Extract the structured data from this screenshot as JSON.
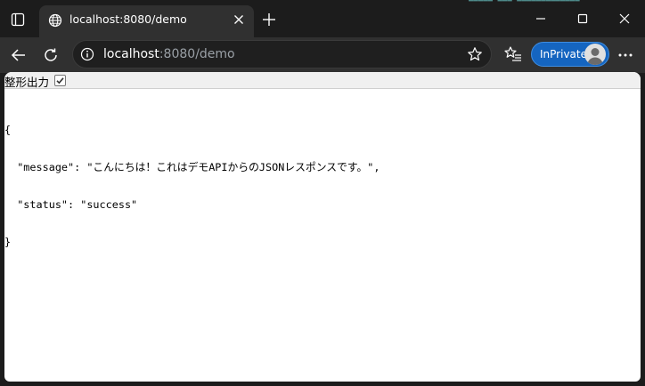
{
  "browser": {
    "tab": {
      "title": "localhost:8080/demo"
    },
    "address": {
      "host": "localhost",
      "rest": ":8080/demo"
    },
    "inprivate_label": "InPrivate",
    "accent": "#1565c0",
    "icons": [
      "tab-actions-icon",
      "globe-icon",
      "close-tab-icon",
      "new-tab-icon",
      "minimize-icon",
      "maximize-icon",
      "close-window-icon",
      "back-icon",
      "refresh-icon",
      "info-icon",
      "star-icon",
      "favorites-icon",
      "avatar",
      "more-icon"
    ]
  },
  "page": {
    "pretty_print_label": "整形出力",
    "pretty_print_checked": true,
    "json_lines": [
      "{",
      "  \"message\": \"こんにちは！これはデモAPIからのJSONレスポンスです。\",",
      "  \"status\": \"success\"",
      "}"
    ]
  }
}
